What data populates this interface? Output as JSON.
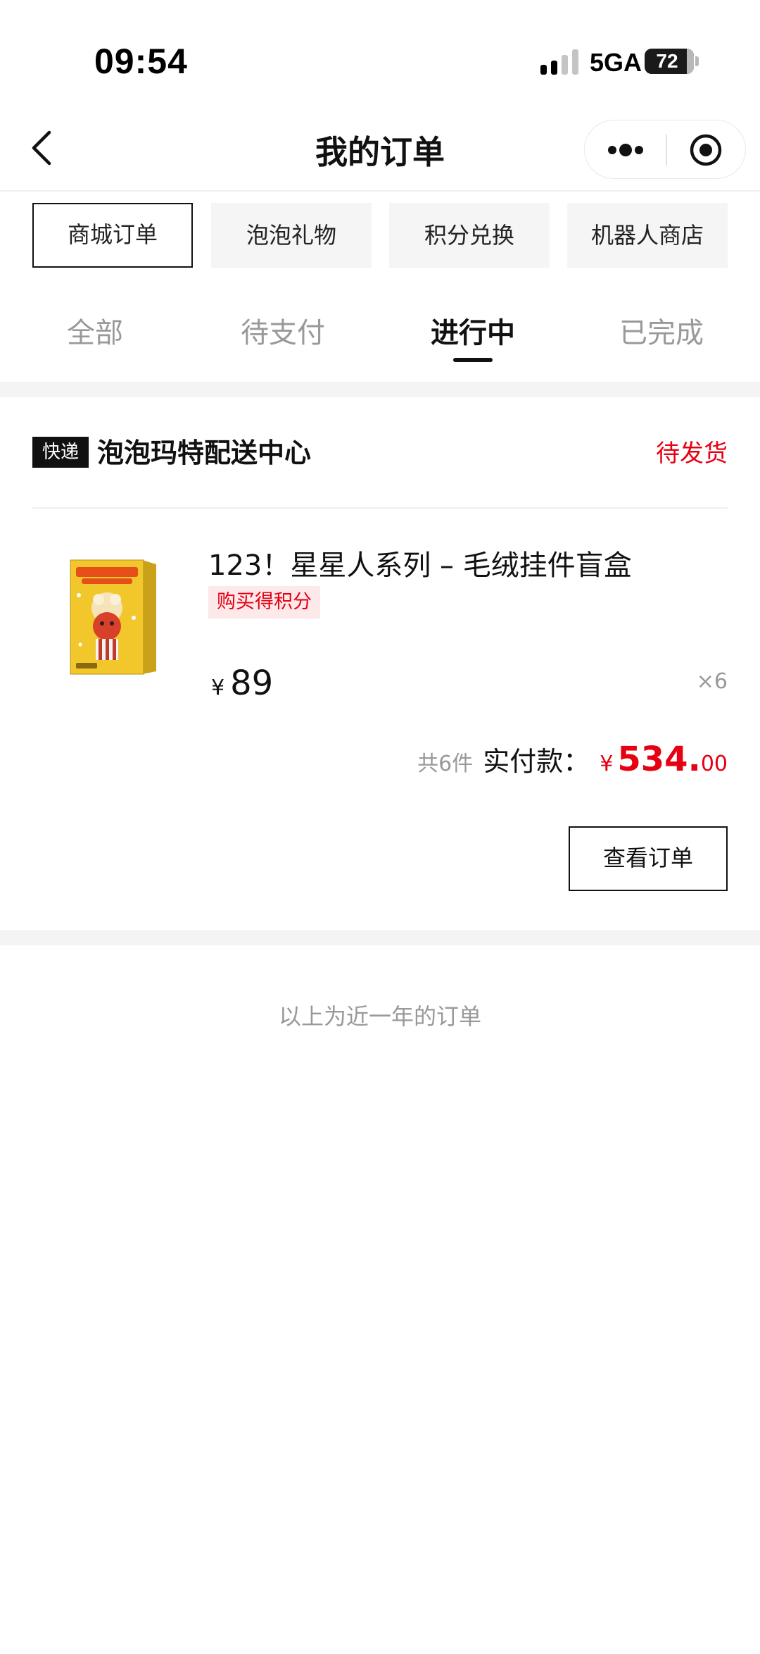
{
  "status_bar": {
    "time": "09:54",
    "network": "5GA",
    "battery": "72",
    "signal_bars_active": 2,
    "signal_bars_total": 4
  },
  "nav": {
    "title": "我的订单",
    "more_icon": "more-dots-icon",
    "close_icon": "target-circle-icon"
  },
  "categories": [
    {
      "label": "商城订单",
      "active": true
    },
    {
      "label": "泡泡礼物",
      "active": false
    },
    {
      "label": "积分兑换",
      "active": false
    },
    {
      "label": "机器人商店",
      "active": false
    }
  ],
  "tabs": [
    {
      "label": "全部",
      "active": false
    },
    {
      "label": "待支付",
      "active": false
    },
    {
      "label": "进行中",
      "active": true
    },
    {
      "label": "已完成",
      "active": false
    }
  ],
  "order": {
    "shipping_badge": "快递",
    "shop_name": "泡泡玛特配送中心",
    "status": "待发货",
    "product": {
      "title": "123！星星人系列 – 毛绒挂件盲盒",
      "points_tag": "购买得积分",
      "currency": "¥",
      "price": "89",
      "quantity": "×6",
      "image_icon": "blind-box-product-image"
    },
    "total_count": "共6件",
    "total_label": "实付款：",
    "total_currency": "¥",
    "total_integer": "534.",
    "total_decimal": "00",
    "view_button": "查看订单"
  },
  "footer_note": "以上为近一年的订单",
  "colors": {
    "accent": "#e60012",
    "primary": "#111111",
    "muted": "#999999",
    "tag_bg": "#fde8ea"
  }
}
